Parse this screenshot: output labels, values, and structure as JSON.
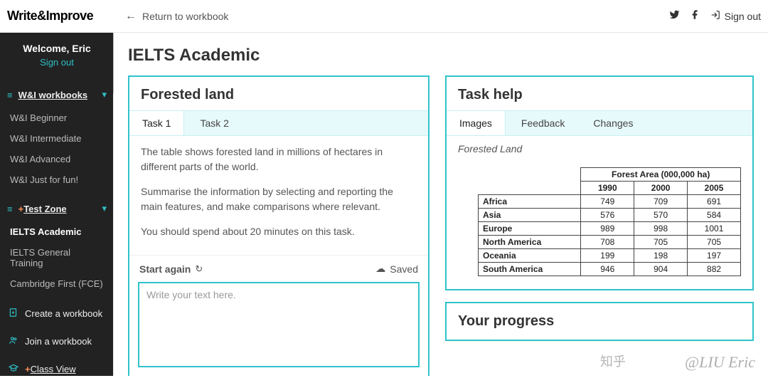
{
  "brand": "Write&Improve",
  "top": {
    "return_label": "Return to workbook",
    "signout_label": "Sign out"
  },
  "sidebar": {
    "welcome": "Welcome, Eric",
    "signout": "Sign out",
    "section1": {
      "label": "W&I workbooks",
      "items": [
        "W&I Beginner",
        "W&I Intermediate",
        "W&I Advanced",
        "W&I Just for fun!"
      ]
    },
    "section2": {
      "label": "Test Zone",
      "items": [
        "IELTS Academic",
        "IELTS General Training",
        "Cambridge First (FCE)"
      ],
      "active_index": 0
    },
    "links": {
      "create": "Create a workbook",
      "join": "Join a workbook",
      "classview": "Class View"
    }
  },
  "page": {
    "title": "IELTS Academic"
  },
  "task": {
    "panel_title": "Forested land",
    "tabs": [
      "Task 1",
      "Task 2"
    ],
    "active_tab": 0,
    "para1": "The table shows forested land in millions of hectares in different parts of the world.",
    "para2": "Summarise the information by selecting and reporting the main features, and make comparisons where relevant.",
    "para3": "You should spend about 20 minutes on this task.",
    "start_label": "Start again",
    "saved_label": "Saved",
    "editor_placeholder": "Write your text here."
  },
  "help": {
    "panel_title": "Task help",
    "tabs": [
      "Images",
      "Feedback",
      "Changes"
    ],
    "active_tab": 0,
    "caption": "Forested Land"
  },
  "chart_data": {
    "type": "table",
    "title": "Forest Area (000,000 ha)",
    "columns": [
      "1990",
      "2000",
      "2005"
    ],
    "rows": [
      {
        "label": "Africa",
        "values": [
          749,
          709,
          691
        ]
      },
      {
        "label": "Asia",
        "values": [
          576,
          570,
          584
        ]
      },
      {
        "label": "Europe",
        "values": [
          989,
          998,
          1001
        ]
      },
      {
        "label": "North America",
        "values": [
          708,
          705,
          705
        ]
      },
      {
        "label": "Oceania",
        "values": [
          199,
          198,
          197
        ]
      },
      {
        "label": "South America",
        "values": [
          946,
          904,
          882
        ]
      }
    ]
  },
  "progress": {
    "panel_title": "Your progress"
  },
  "watermark": {
    "zh": "知乎",
    "name": "@LIU Eric"
  }
}
